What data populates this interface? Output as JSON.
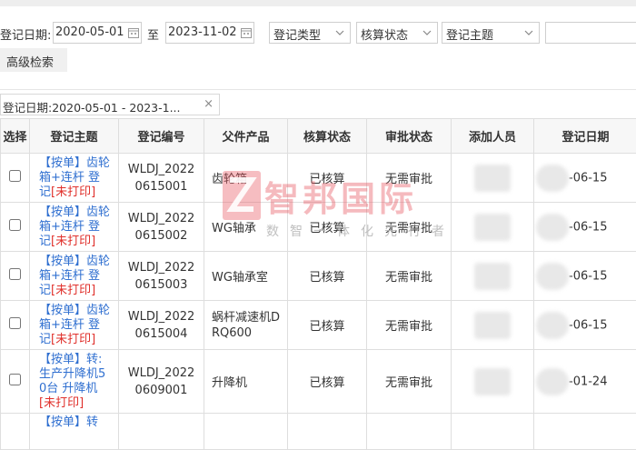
{
  "filters": {
    "date_label": "登记日期:",
    "date_from": "2020-05-01",
    "date_to": "2023-11-02",
    "range_separator": "至",
    "type_select": "登记类型",
    "status_select": "核算状态",
    "subject_select": "登记主题",
    "advanced_search": "高级检索"
  },
  "active_tag": {
    "label": "登记日期:2020-05-01 - 2023-1...",
    "close": "×"
  },
  "table": {
    "headers": {
      "select": "选择",
      "subject": "登记主题",
      "code": "登记编号",
      "parent": "父件产品",
      "accounting": "核算状态",
      "approval": "审批状态",
      "user": "添加人员",
      "date": "登记日期"
    },
    "rows": [
      {
        "subject_lines": [
          "【按单】齿轮",
          "箱+连杆 登",
          "记"
        ],
        "flag": "[未打印]",
        "code_lines": [
          "WLDJ_2022",
          "0615001"
        ],
        "parent": "齿轮箱",
        "accounting": "已核算",
        "approval": "无需审批",
        "date": "-06-15"
      },
      {
        "subject_lines": [
          "【按单】齿轮",
          "箱+连杆 登",
          "记"
        ],
        "flag": "[未打印]",
        "code_lines": [
          "WLDJ_2022",
          "0615002"
        ],
        "parent": "WG轴承",
        "accounting": "已核算",
        "approval": "无需审批",
        "date": "-06-15"
      },
      {
        "subject_lines": [
          "【按单】齿轮",
          "箱+连杆 登",
          "记"
        ],
        "flag": "[未打印]",
        "code_lines": [
          "WLDJ_2022",
          "0615003"
        ],
        "parent": "WG轴承室",
        "accounting": "已核算",
        "approval": "无需审批",
        "date": "-06-15"
      },
      {
        "subject_lines": [
          "【按单】齿轮",
          "箱+连杆 登",
          "记"
        ],
        "flag": "[未打印]",
        "code_lines": [
          "WLDJ_2022",
          "0615004"
        ],
        "parent": "蜗杆减速机DRQ600",
        "accounting": "已核算",
        "approval": "无需审批",
        "date": "-06-15"
      },
      {
        "subject_lines": [
          "【按单】转:",
          "生产升降机5",
          "0台 升降机"
        ],
        "flag": "[未打印]",
        "code_lines": [
          "WLDJ_2022",
          "0609001"
        ],
        "parent": "升降机",
        "accounting": "已核算",
        "approval": "无需审批",
        "date": "-01-24"
      }
    ],
    "partial_row_subject": "【按单】转"
  },
  "watermark": {
    "title": "智邦国际",
    "slogan": "数智一体化先行者"
  },
  "colors": {
    "link": "#2f6fd0",
    "flag": "#e0302b",
    "header_bg": "#f7f7f7",
    "border": "#dedede"
  },
  "icons": {
    "calendar": "calendar-icon",
    "chevron": "chevron-down-icon",
    "close": "close-icon"
  }
}
